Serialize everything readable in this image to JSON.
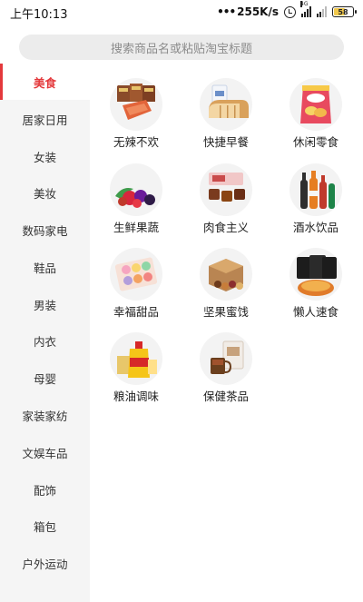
{
  "status_bar": {
    "time": "上午10:13",
    "network_speed": "255K/s",
    "network_type": "4G",
    "battery": "58"
  },
  "search": {
    "placeholder": "搜索商品名或粘贴淘宝标题"
  },
  "sidebar": {
    "items": [
      {
        "label": "美食",
        "active": true
      },
      {
        "label": "居家日用"
      },
      {
        "label": "女装"
      },
      {
        "label": "美妆"
      },
      {
        "label": "数码家电"
      },
      {
        "label": "鞋品"
      },
      {
        "label": "男装"
      },
      {
        "label": "内衣"
      },
      {
        "label": "母婴"
      },
      {
        "label": "家装家纺"
      },
      {
        "label": "文娱车品"
      },
      {
        "label": "配饰"
      },
      {
        "label": "箱包"
      },
      {
        "label": "户外运动"
      }
    ]
  },
  "categories": [
    {
      "label": "无辣不欢",
      "icon": "spicy-snack-pack-icon"
    },
    {
      "label": "快捷早餐",
      "icon": "bread-milk-icon"
    },
    {
      "label": "休闲零食",
      "icon": "chips-bag-icon"
    },
    {
      "label": "生鲜果蔬",
      "icon": "fresh-fruit-icon"
    },
    {
      "label": "肉食主义",
      "icon": "beef-cubes-icon"
    },
    {
      "label": "酒水饮品",
      "icon": "drink-bottles-icon"
    },
    {
      "label": "幸福甜品",
      "icon": "macaron-box-icon"
    },
    {
      "label": "坚果蜜饯",
      "icon": "nut-gift-box-icon"
    },
    {
      "label": "懒人速食",
      "icon": "instant-noodles-icon"
    },
    {
      "label": "粮油调味",
      "icon": "cooking-oil-icon"
    },
    {
      "label": "保健茶品",
      "icon": "tea-box-icon"
    }
  ],
  "colors": {
    "accent": "#e4393c",
    "sidebar_bg": "#f5f5f5",
    "search_bg": "#ececec"
  }
}
